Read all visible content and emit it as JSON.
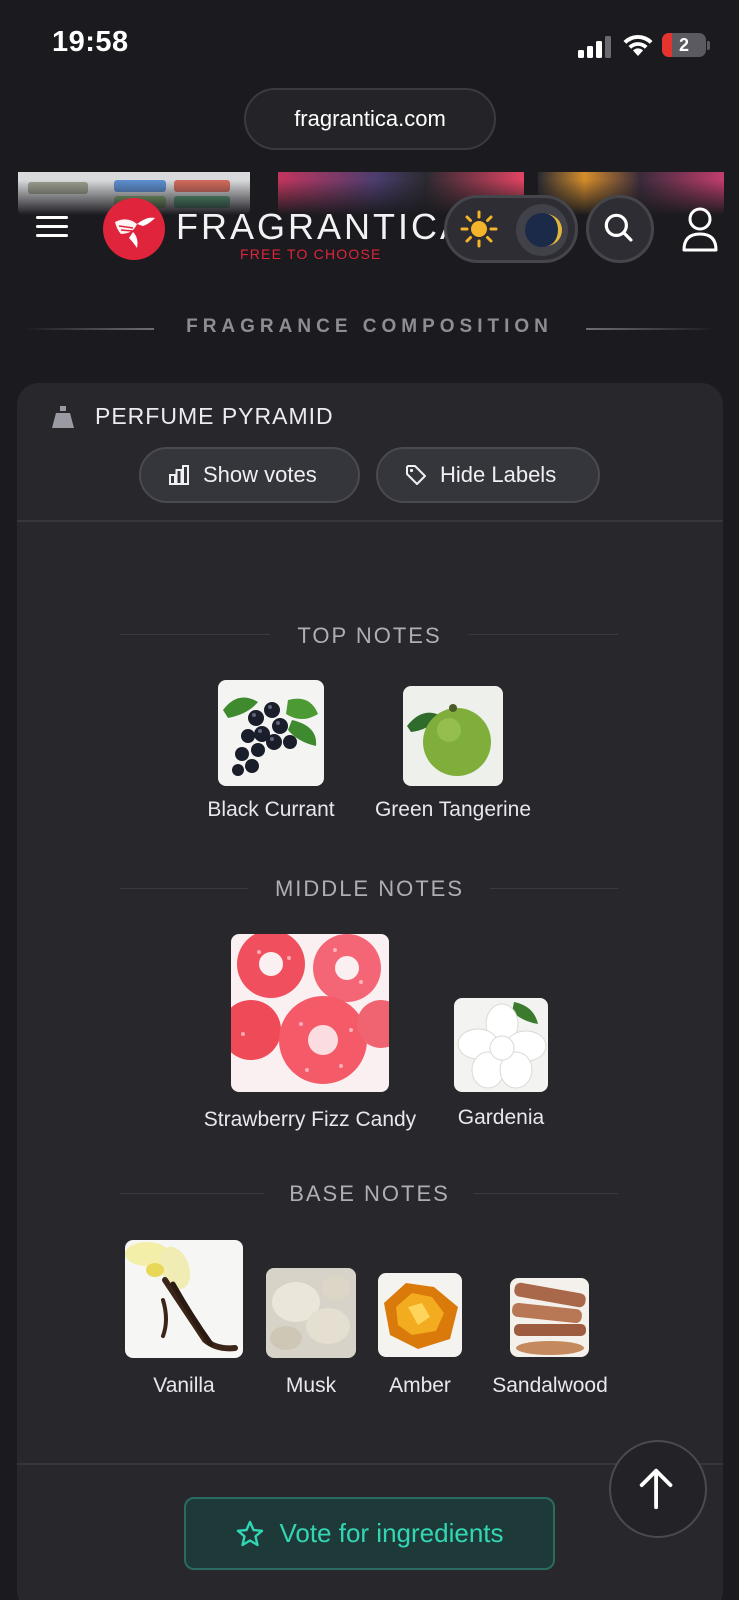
{
  "status_bar": {
    "time": "19:58",
    "battery": "2"
  },
  "browser": {
    "url": "fragrantica.com"
  },
  "header": {
    "brand": "FRAGRANTICA",
    "tagline": "FREE TO CHOOSE",
    "icons": [
      "menu-icon",
      "sun-icon",
      "moon-icon",
      "search-icon",
      "user-icon"
    ]
  },
  "section": {
    "title": "FRAGRANCE COMPOSITION"
  },
  "pyramid": {
    "title": "PERFUME PYRAMID",
    "show_votes_label": "Show votes",
    "hide_labels_label": "Hide Labels",
    "top_title": "TOP NOTES",
    "top_notes": [
      "Black Currant",
      "Green Tangerine"
    ],
    "middle_title": "MIDDLE NOTES",
    "middle_notes": [
      "Strawberry Fizz Candy",
      "Gardenia"
    ],
    "base_title": "BASE NOTES",
    "base_notes": [
      "Vanilla",
      "Musk",
      "Amber",
      "Sandalwood"
    ]
  },
  "vote": {
    "label": "Vote for ingredients"
  },
  "colors": {
    "accent": "#e0243b",
    "teal": "#33d6b4",
    "background": "#1b1b1f",
    "card": "#27272c"
  }
}
